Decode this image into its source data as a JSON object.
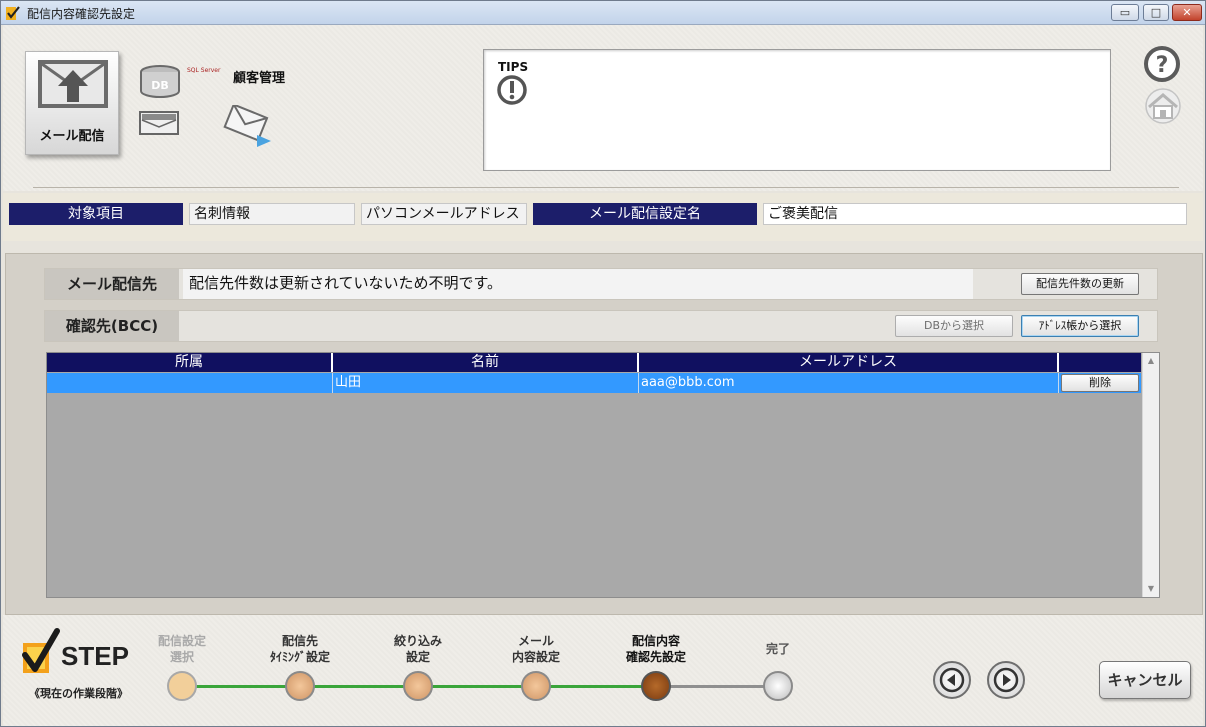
{
  "window": {
    "title": "配信内容確認先設定"
  },
  "header": {
    "mail_tile_label": "メール配信",
    "db_badge": "DB",
    "sql_logo_text": "SQL Server",
    "customer_mgmt_label": "顧客管理",
    "tips_title": "TIPS"
  },
  "info_bar": {
    "target_label": "対象項目",
    "target_value1": "名刺情報",
    "target_value2": "パソコンメールアドレス",
    "setting_name_label": "メール配信設定名",
    "setting_name_value": "ご褒美配信"
  },
  "delivery": {
    "label": "メール配信先",
    "message": "配信先件数は更新されていないため不明です。",
    "update_button": "配信先件数の更新"
  },
  "bcc": {
    "label": "確認先(BCC)",
    "db_select_button": "DBから選択",
    "address_book_button": "ｱﾄﾞﾚｽ帳から選択"
  },
  "grid": {
    "columns": [
      "所属",
      "名前",
      "メールアドレス",
      ""
    ],
    "rows": [
      {
        "affiliation": "",
        "name": "山田",
        "email": "aaa@bbb.com",
        "action": "削除"
      }
    ]
  },
  "steps": {
    "logo_text": "STEP",
    "subtitle": "《現在の作業段階》",
    "items": [
      {
        "line1": "配信設定",
        "line2": "選択",
        "state": "done"
      },
      {
        "line1": "配信先",
        "line2": "ﾀｲﾐﾝｸﾞ設定",
        "state": "done"
      },
      {
        "line1": "絞り込み",
        "line2": "設定",
        "state": "done"
      },
      {
        "line1": "メール",
        "line2": "内容設定",
        "state": "done"
      },
      {
        "line1": "配信内容",
        "line2": "確認先設定",
        "state": "current"
      },
      {
        "line1": "完了",
        "line2": "",
        "state": "pending"
      }
    ]
  },
  "footer": {
    "cancel_button": "キャンセル"
  },
  "colors": {
    "navy": "#1c1e6a",
    "selection": "#3399ff",
    "step_done": "#e3b587",
    "step_current": "#8a4b18",
    "progress_line": "#3aa53a"
  }
}
